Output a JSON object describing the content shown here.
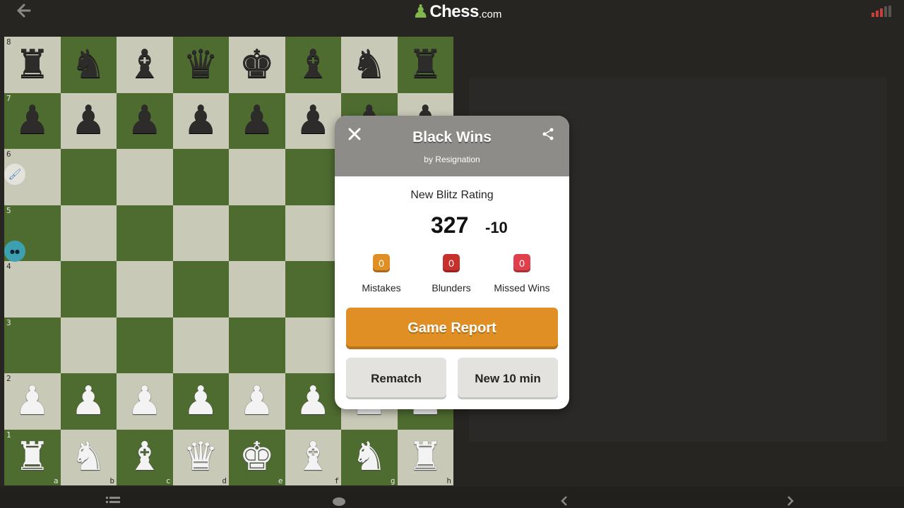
{
  "app": {
    "back_icon": "arrow-left-icon",
    "logo_main": "Chess",
    "logo_suffix": ".com",
    "signal_icon": "connection-strength-icon"
  },
  "board": {
    "ranks": [
      "8",
      "7",
      "6",
      "5",
      "4",
      "3",
      "2",
      "1"
    ],
    "files": [
      "a",
      "b",
      "c",
      "d",
      "e",
      "f",
      "g",
      "h"
    ],
    "rows": [
      [
        "♜",
        "♞",
        "♝",
        "♛",
        "♚",
        "♝",
        "♞",
        "♜"
      ],
      [
        "♟",
        "♟",
        "♟",
        "♟",
        "♟",
        "♟",
        "♟",
        "♟"
      ],
      [
        "",
        "",
        "",
        "",
        "",
        "",
        "",
        ""
      ],
      [
        "",
        "",
        "",
        "",
        "",
        "",
        "",
        ""
      ],
      [
        "",
        "",
        "",
        "",
        "",
        "",
        "",
        ""
      ],
      [
        "",
        "",
        "",
        "",
        "",
        "",
        "",
        ""
      ],
      [
        "♟",
        "♟",
        "♟",
        "♟",
        "♟",
        "♟",
        "♟",
        "♟"
      ],
      [
        "♜",
        "♞",
        "♝",
        "♛",
        "♚",
        "♝",
        "♞",
        "♜"
      ]
    ],
    "piece_colors": [
      "black",
      "black",
      "",
      "",
      "",
      "",
      "white",
      "white"
    ],
    "colors": {
      "light": "#c9c9b8",
      "dark": "#4e6b30"
    }
  },
  "modal": {
    "title": "Black Wins",
    "subtitle": "by Resignation",
    "rating_label": "New Blitz Rating",
    "rating": "327",
    "rating_change": "-10",
    "stats": [
      {
        "count": "0",
        "label": "Mistakes",
        "color": "#e08f24"
      },
      {
        "count": "0",
        "label": "Blunders",
        "color": "#c8302c"
      },
      {
        "count": "0",
        "label": "Missed Wins",
        "color": "#e0404b"
      }
    ],
    "report_label": "Game Report",
    "rematch_label": "Rematch",
    "new_game_label": "New 10 min"
  },
  "bottom_nav": [
    "list-icon",
    "chat-icon",
    "previous-move-icon",
    "next-move-icon"
  ]
}
